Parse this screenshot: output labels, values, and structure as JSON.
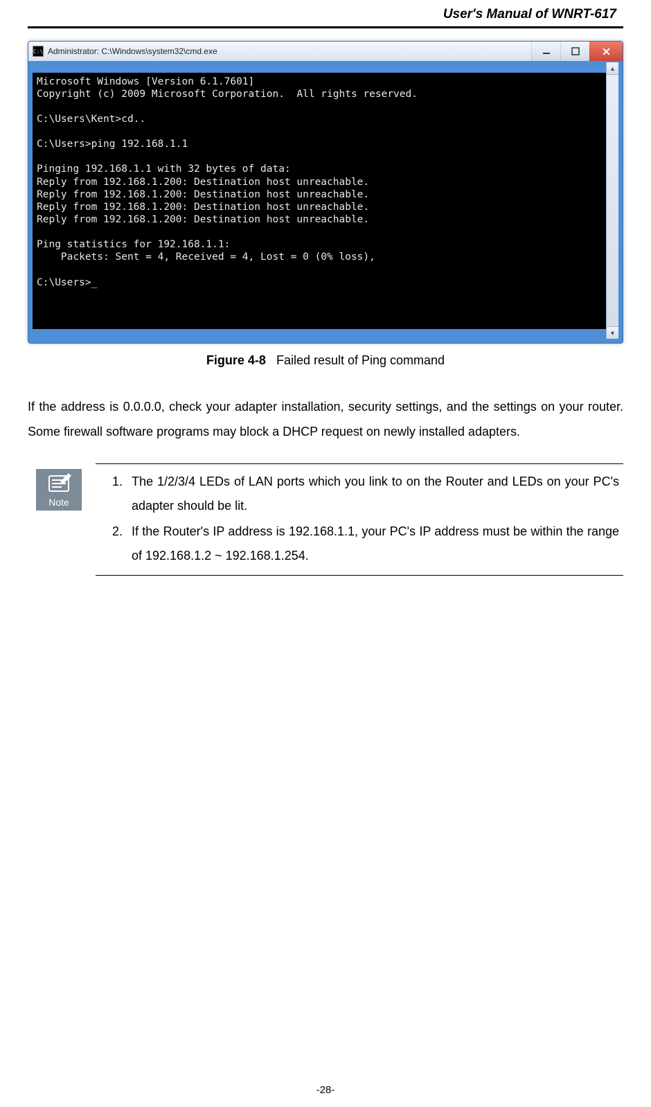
{
  "header": {
    "title": "User's Manual of WNRT-617"
  },
  "cmd": {
    "icon_text": "C:\\",
    "titlebar": "Administrator: C:\\Windows\\system32\\cmd.exe",
    "lines": [
      "Microsoft Windows [Version 6.1.7601]",
      "Copyright (c) 2009 Microsoft Corporation.  All rights reserved.",
      "",
      "C:\\Users\\Kent>cd..",
      "",
      "C:\\Users>ping 192.168.1.1",
      "",
      "Pinging 192.168.1.1 with 32 bytes of data:",
      "Reply from 192.168.1.200: Destination host unreachable.",
      "Reply from 192.168.1.200: Destination host unreachable.",
      "Reply from 192.168.1.200: Destination host unreachable.",
      "Reply from 192.168.1.200: Destination host unreachable.",
      "",
      "Ping statistics for 192.168.1.1:",
      "    Packets: Sent = 4, Received = 4, Lost = 0 (0% loss),",
      "",
      "C:\\Users>_"
    ]
  },
  "caption": {
    "label": "Figure 4-8",
    "text": "Failed result of Ping command"
  },
  "paragraph": "If the address is 0.0.0.0, check your adapter installation, security settings, and the settings on your router. Some firewall software programs may block a DHCP request on newly installed adapters.",
  "note": {
    "badge": "Note",
    "items": [
      "The 1/2/3/4 LEDs of LAN ports which you link to on the Router and LEDs on your PC's adapter should be lit.",
      "If the Router's IP address is 192.168.1.1, your PC's IP address must be within the range of 192.168.1.2 ~ 192.168.1.254."
    ]
  },
  "page_number": "-28-"
}
